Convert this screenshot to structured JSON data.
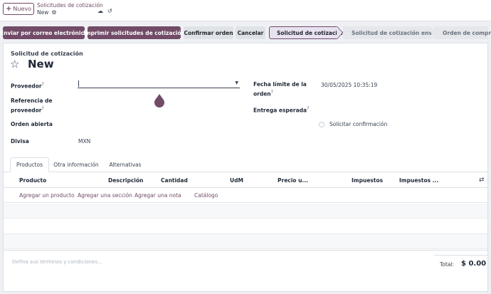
{
  "header": {
    "new_label": "Nuevo",
    "breadcrumb": "Solicitudes de cotización",
    "record": "New"
  },
  "actions": {
    "email": "Enviar por correo electrónico",
    "print": "Imprimir solicitudes de cotización",
    "confirm": "Confirmar orden",
    "cancel": "Cancelar"
  },
  "statusbar": [
    "Solicitud de cotización",
    "Solicitud de cotización enviada",
    "Orden de compra"
  ],
  "form": {
    "doc_type": "Solicitud de cotización",
    "name": "New",
    "vendor_label": "Proveedor",
    "vendor_ref_label_1": "Referencia de",
    "vendor_ref_label_2": "proveedor",
    "blanket_label": "Orden abierta",
    "currency_label": "Divisa",
    "currency_value": "MXN",
    "deadline_label_1": "Fecha límite de la",
    "deadline_label_2": "orden",
    "deadline_value": "30/05/2025 10:35:19",
    "expected_label": "Entrega esperada",
    "ack_label": "Solicitar confirmación",
    "help_mark": "?"
  },
  "tabs": [
    "Productos",
    "Otra información",
    "Alternativas"
  ],
  "table": {
    "columns": [
      "Producto",
      "Descripción",
      "Cantidad",
      "UdM",
      "Precio u...",
      "Impuestos",
      "Impuestos ..."
    ],
    "add_links": [
      "Agregar un producto",
      "Agregar una sección",
      "Agregar una nota",
      "Catálogo"
    ]
  },
  "footer": {
    "terms_placeholder": "Defina sus términos y condiciones...",
    "total_label": "Total:",
    "total_value": "$ 0.00"
  },
  "colors": {
    "brand": "#714b67"
  }
}
